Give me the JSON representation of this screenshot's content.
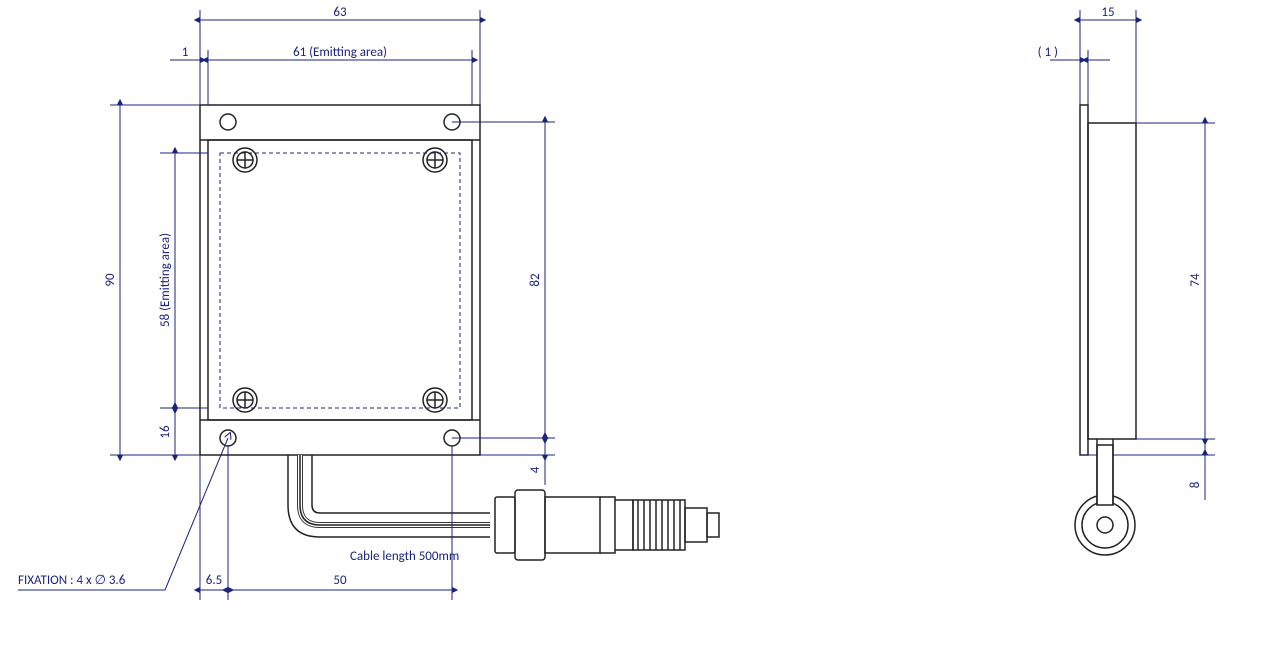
{
  "front": {
    "width_overall": "63",
    "width_emitting": "61 (Emitting area)",
    "width_offset": "1",
    "height_overall": "90",
    "height_emitting": "58 (Emitting area)",
    "height_bottom": "16",
    "hole_pitch_v": "82",
    "hole_offset_b": "4",
    "hole_offset_l": "6.5",
    "hole_pitch_h": "50",
    "cable_note": "Cable length 500mm",
    "fixation_note": "FIXATION : 4 x ∅ 3.6"
  },
  "side": {
    "thick_overall": "15",
    "front_plate": "( 1 )",
    "body_h": "74",
    "cable_dia": "8"
  }
}
